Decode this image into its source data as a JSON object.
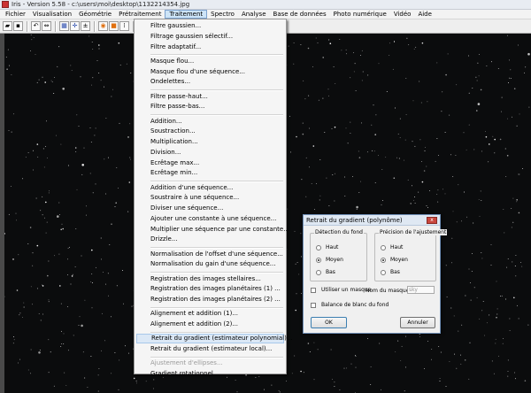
{
  "window": {
    "title": "Iris - Version 5.58 - c:\\users\\moi\\desktop\\1132214354.jpg"
  },
  "menubar": {
    "items": [
      "Fichier",
      "Visualisation",
      "Géométrie",
      "Prétraitement",
      "Traitement",
      "Spectro",
      "Analyse",
      "Base de données",
      "Photo numérique",
      "Vidéo",
      "Aide"
    ],
    "active": "Traitement"
  },
  "toolbar": {
    "icons": [
      "open-folder-icon",
      "save-icon",
      "undo-icon",
      "resize-icon",
      "grid-icon",
      "move-icon",
      "zoom-icon",
      "target-icon",
      "square-icon",
      "threshold-icon",
      "list-icon"
    ],
    "glyphs": [
      "▰",
      "▪",
      "↶",
      "⇔",
      "▦",
      "✛",
      "±",
      "◉",
      "■",
      "⁞",
      "≡"
    ],
    "accent": "#e07010"
  },
  "menu": {
    "items": [
      "Filtre gaussien...",
      "Filtrage gaussien sélectif...",
      "Filtre adaptatif...",
      "Masque flou...",
      "Masque flou d'une séquence...",
      "Ondelettes...",
      "Filtre passe-haut...",
      "Filtre passe-bas...",
      "Addition...",
      "Soustraction...",
      "Multiplication...",
      "Division...",
      "Ecrêtage max...",
      "Ecrêtage min...",
      "Addition d'une séquence...",
      "Soustraire à une séquence...",
      "Diviser une séquence...",
      "Ajouter une constante à une séquence...",
      "Multiplier une séquence par une constante...",
      "Drizzle...",
      "Normalisation de l'offset d'une séquence...",
      "Normalisation du gain d'une séquence...",
      "Registration des images stellaires...",
      "Registration des images planétaires (1) ...",
      "Registration des images planétaires (2) ...",
      "Alignement et addition (1)...",
      "Alignement et addition (2)...",
      "Retrait du gradient (estimateur polynomial)...",
      "Retrait du gradient (estimateur local)...",
      "Ajustement d'ellipses...",
      "Gradient rotationnel..."
    ],
    "highlighted": "Retrait du gradient (estimateur polynomial)...",
    "disabled": [
      "Ajustement d'ellipses..."
    ]
  },
  "dialog": {
    "title": "Retrait du gradient (polynôme)",
    "close": "x",
    "detection": {
      "legend": "Détection du fond",
      "options": [
        "Haut",
        "Moyen",
        "Bas"
      ],
      "selected": "Moyen"
    },
    "precision": {
      "legend": "Précision de l'ajustement",
      "options": [
        "Haut",
        "Moyen",
        "Bas"
      ],
      "selected": "Moyen"
    },
    "use_mask_label": "Utiliser un masque",
    "use_mask_checked": false,
    "mask_name_label": "Nom du masque :",
    "mask_name_placeholder": "sky",
    "white_balance_label": "Balance de blanc du fond",
    "white_balance_checked": false,
    "ok_label": "OK",
    "cancel_label": "Annuler"
  }
}
